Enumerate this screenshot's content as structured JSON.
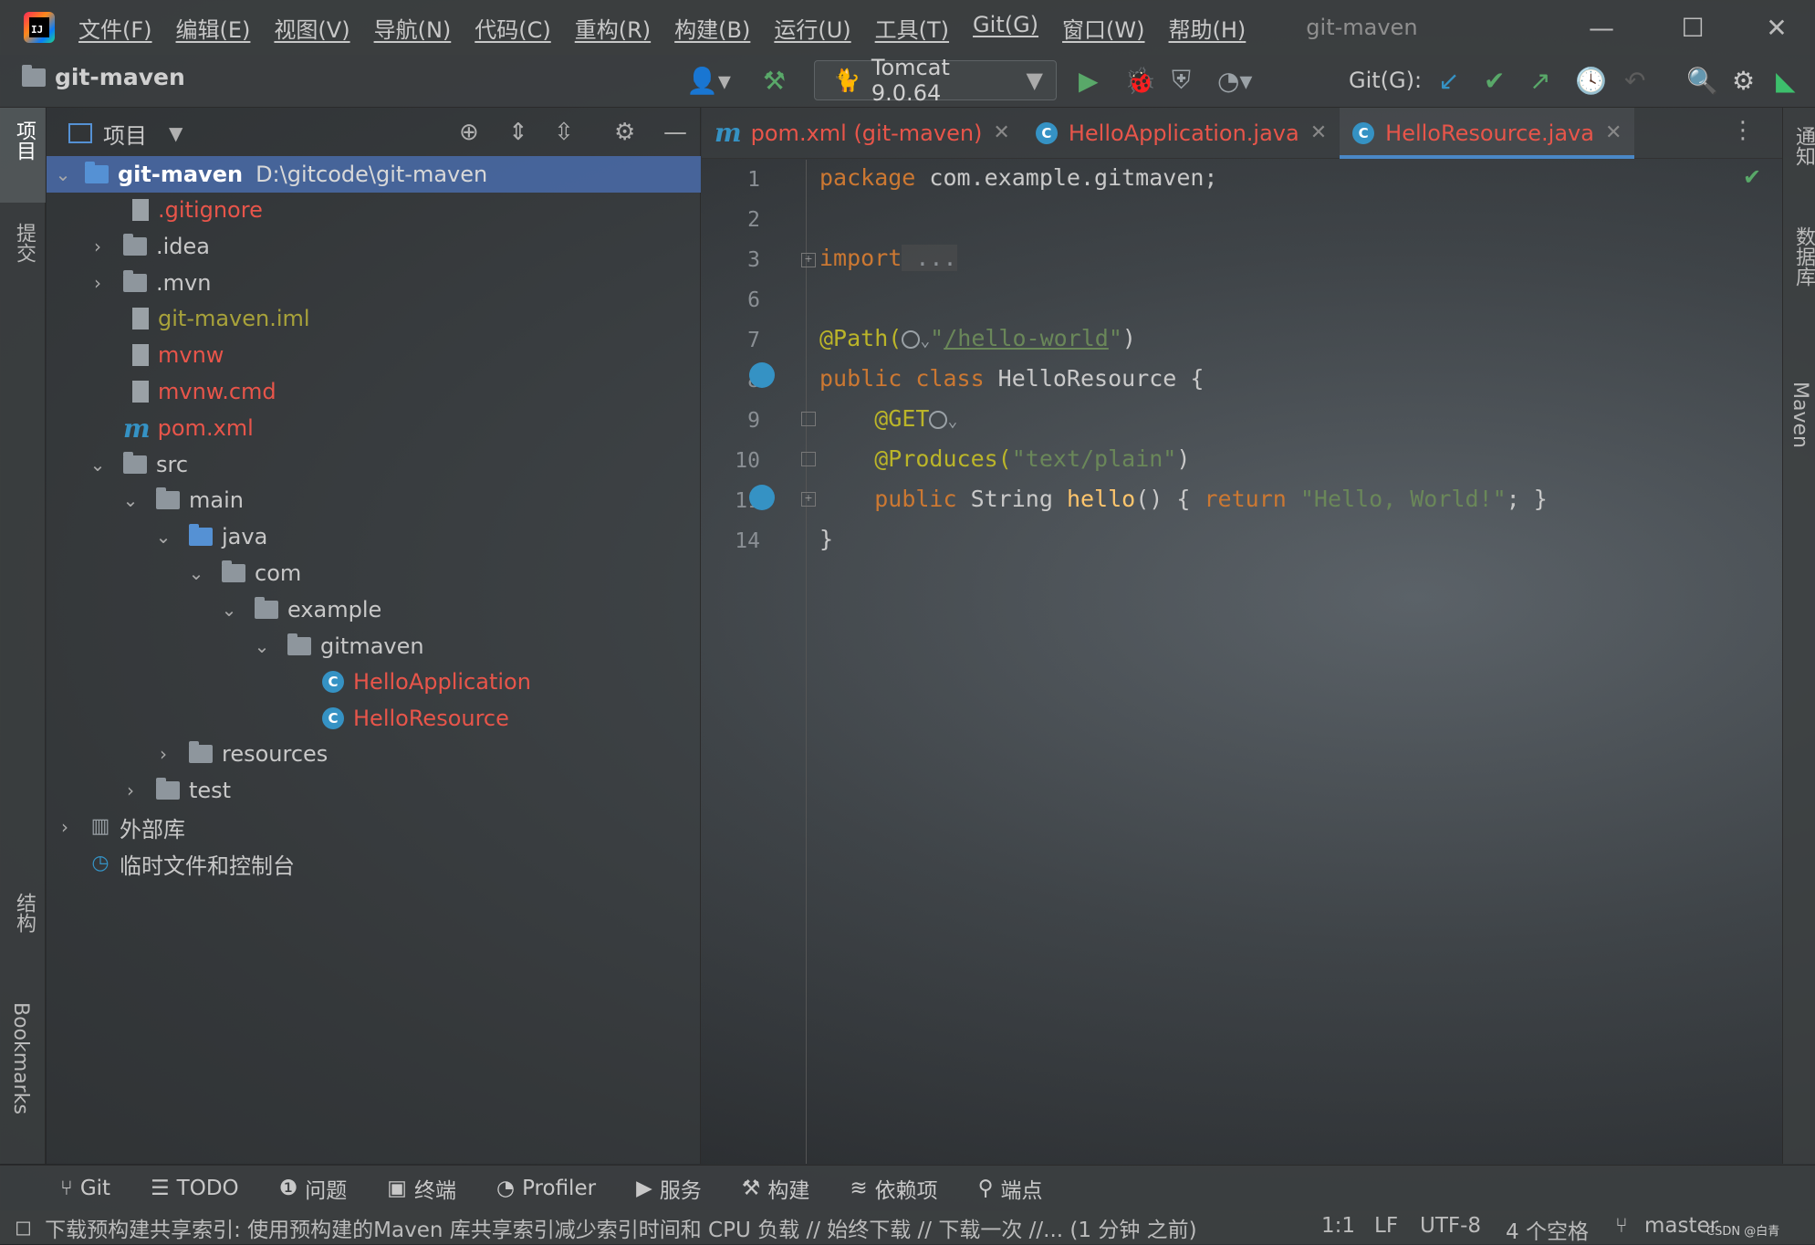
{
  "app": {
    "window_title": "git-maven",
    "project_name": "git-maven"
  },
  "menu": [
    {
      "label": "文件(F)"
    },
    {
      "label": "编辑(E)"
    },
    {
      "label": "视图(V)"
    },
    {
      "label": "导航(N)"
    },
    {
      "label": "代码(C)"
    },
    {
      "label": "重构(R)"
    },
    {
      "label": "构建(B)"
    },
    {
      "label": "运行(U)"
    },
    {
      "label": "工具(T)"
    },
    {
      "label": "Git(G)"
    },
    {
      "label": "窗口(W)"
    },
    {
      "label": "帮助(H)"
    }
  ],
  "toolbar": {
    "run_config": "Tomcat 9.0.64",
    "git_label": "Git(G):"
  },
  "left_strip": {
    "project": "项目",
    "commit": "提交",
    "structure": "结构",
    "bookmarks": "Bookmarks"
  },
  "right_strip": {
    "notifications": "通知",
    "database": "数据库",
    "maven": "Maven"
  },
  "project_panel": {
    "title": "项目",
    "tree": {
      "root_name": "git-maven",
      "root_path": "D:\\gitcode\\git-maven",
      "gitignore": ".gitignore",
      "idea": ".idea",
      "mvn": ".mvn",
      "iml": "git-maven.iml",
      "mvnw": "mvnw",
      "mvnw_cmd": "mvnw.cmd",
      "pom": "pom.xml",
      "src": "src",
      "main": "main",
      "java": "java",
      "com": "com",
      "example": "example",
      "gitmaven": "gitmaven",
      "hello_app": "HelloApplication",
      "hello_res": "HelloResource",
      "resources": "resources",
      "test": "test",
      "external_libs": "外部库",
      "scratches": "临时文件和控制台"
    }
  },
  "editor": {
    "tabs": [
      {
        "label": "pom.xml (git-maven)"
      },
      {
        "label": "HelloApplication.java"
      },
      {
        "label": "HelloResource.java"
      }
    ],
    "line_numbers": [
      "1",
      "2",
      "3",
      "6",
      "7",
      "8",
      "9",
      "10",
      "11",
      "14"
    ],
    "code": {
      "l1_kw": "package",
      "l1_rest": " com.example.gitmaven;",
      "l3_kw": "import",
      "l3_rest": " ...",
      "l7_ann": "@Path(",
      "l7_str_open": "\"",
      "l7_link": "/hello-world",
      "l7_str_close": "\"",
      "l7_close": ")",
      "l8_kw": "public class",
      "l8_rest": " HelloResource {",
      "l9_ann": "@GET",
      "l10_ann": "@Produces(",
      "l10_str": "\"text/plain\"",
      "l10_close": ")",
      "l11_kw": "public",
      "l11_type": " String ",
      "l11_meth": "hello",
      "l11_paren": "() { ",
      "l11_ret": "return",
      "l11_str": " \"Hello, World!\"",
      "l11_end": "; }",
      "l14": "}"
    }
  },
  "bottom_tools": [
    {
      "label": "Git"
    },
    {
      "label": "TODO"
    },
    {
      "label": "问题"
    },
    {
      "label": "终端"
    },
    {
      "label": "Profiler"
    },
    {
      "label": "服务"
    },
    {
      "label": "构建"
    },
    {
      "label": "依赖项"
    },
    {
      "label": "端点"
    }
  ],
  "status": {
    "message": "下载预构建共享索引: 使用预构建的Maven 库共享索引减少索引时间和 CPU 负载 // 始终下载 // 下载一次 //... (1 分钟 之前)",
    "position": "1:1",
    "line_sep": "LF",
    "encoding": "UTF-8",
    "indent": "4 个空格",
    "branch": "master"
  },
  "watermark": "CSDN @白青"
}
